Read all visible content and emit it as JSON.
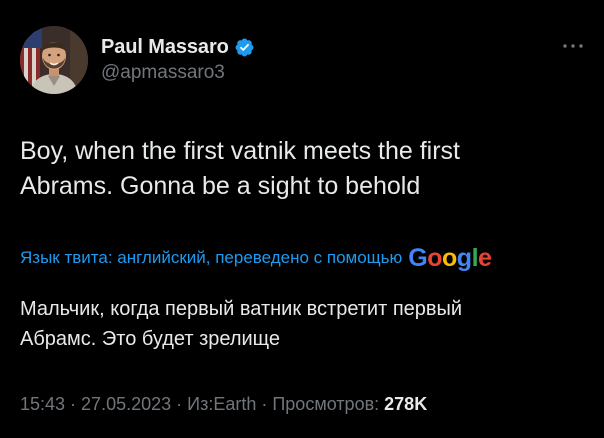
{
  "author": {
    "display_name": "Paul Massaro",
    "handle": "@apmassaro3",
    "verified": true
  },
  "tweet": {
    "text_line1": "Boy, when the first vatnik meets the first",
    "text_line2": "Abrams. Gonna be a sight to behold"
  },
  "translation": {
    "label": "Язык твита: английский, переведено с помощью",
    "provider_letters": [
      "G",
      "o",
      "o",
      "g",
      "l",
      "e"
    ],
    "text_line1": "Мальчик, когда первый ватник встретит первый",
    "text_line2": "Абрамс. Это будет зрелище"
  },
  "meta": {
    "time": "15:43",
    "separator": " · ",
    "date": "27.05.2023",
    "source": "Из:Earth",
    "views_label": "Просмотров:",
    "views_count": "278K"
  },
  "colors": {
    "background": "#000000",
    "text_primary": "#e7e9ea",
    "text_secondary": "#71767b",
    "accent_blue": "#1d9bf0",
    "google_blue": "#4285f4",
    "google_red": "#ea4335",
    "google_yellow": "#fbbc05",
    "google_green": "#34a853"
  },
  "icons": {
    "verified": "verified-badge-icon",
    "more": "more-options-icon"
  }
}
